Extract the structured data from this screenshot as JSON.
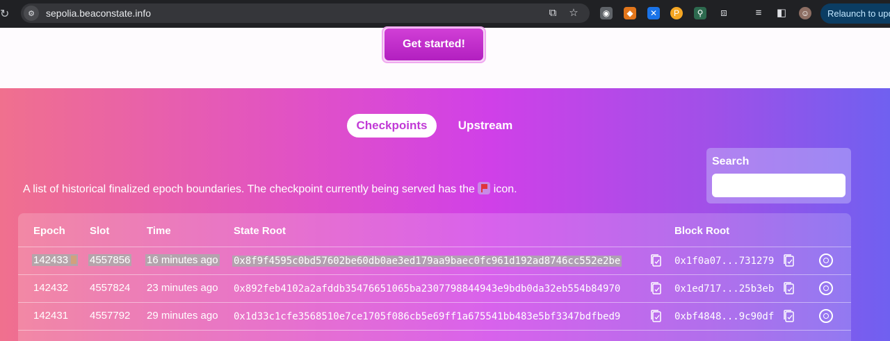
{
  "browser": {
    "url": "sepolia.beaconstate.info",
    "relaunch_label": "Relaunch to update"
  },
  "header": {
    "cta_label": "Get started!"
  },
  "tabs": [
    {
      "label": "Checkpoints",
      "active": true
    },
    {
      "label": "Upstream",
      "active": false
    }
  ],
  "description": {
    "before_icon": "A list of historical finalized epoch boundaries. The checkpoint currently being served has the",
    "after_icon": "icon."
  },
  "search": {
    "label": "Search",
    "placeholder": ""
  },
  "table": {
    "headers": [
      "Epoch",
      "Slot",
      "Time",
      "State Root",
      "Block Root"
    ],
    "rows": [
      {
        "epoch": "142433",
        "slot": "4557856",
        "time": "16 minutes ago",
        "state_root": "0x8f9f4595c0bd57602be60db0ae3ed179aa9baec0fc961d192ad8746cc552e2be",
        "block_root": "0x1f0a07...731279",
        "current": true
      },
      {
        "epoch": "142432",
        "slot": "4557824",
        "time": "23 minutes ago",
        "state_root": "0x892feb4102a2afddb35476651065ba2307798844943e9bdb0da32eb554b84970",
        "block_root": "0x1ed717...25b3eb",
        "current": false
      },
      {
        "epoch": "142431",
        "slot": "4557792",
        "time": "29 minutes ago",
        "state_root": "0x1d33c1cfe3568510e7ce1705f086cb5e69ff1a675541bb483e5bf3347bdfbed9",
        "block_root": "0xbf4848...9c90df",
        "current": false
      }
    ]
  },
  "colors": {
    "accent": "#c13ad6",
    "cta": "#b21fc0",
    "flag": "#e0343c"
  },
  "icons": [
    "reload-icon",
    "site-info-icon",
    "install-icon",
    "star-icon",
    "copy-icon",
    "magnifier-icon",
    "flag-icon"
  ]
}
